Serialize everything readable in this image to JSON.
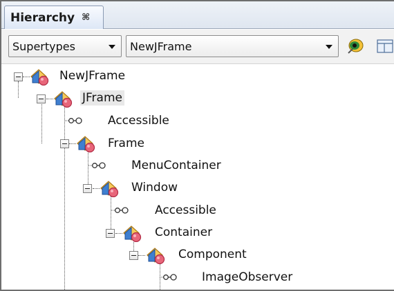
{
  "tab": {
    "title": "Hierarchy",
    "close_glyph": "⌘"
  },
  "toolbar": {
    "mode_select": {
      "value": "Supertypes"
    },
    "class_select": {
      "value": "NewJFrame"
    }
  },
  "icons": {
    "class": "class-icon",
    "interface": "interface-icon",
    "expanded": "collapse-toggle-icon",
    "eye": "eye-icon",
    "views": "view-layout-icon"
  },
  "tree": [
    {
      "label": "NewJFrame",
      "kind": "class",
      "depth": 0,
      "expanded": true
    },
    {
      "label": "JFrame",
      "kind": "class",
      "depth": 1,
      "expanded": true,
      "selected": true
    },
    {
      "label": "Accessible",
      "kind": "interface",
      "depth": 2
    },
    {
      "label": "Frame",
      "kind": "class",
      "depth": 2,
      "expanded": true
    },
    {
      "label": "MenuContainer",
      "kind": "interface",
      "depth": 3
    },
    {
      "label": "Window",
      "kind": "class",
      "depth": 3,
      "expanded": true
    },
    {
      "label": "Accessible",
      "kind": "interface",
      "depth": 4
    },
    {
      "label": "Container",
      "kind": "class",
      "depth": 4,
      "expanded": true
    },
    {
      "label": "Component",
      "kind": "class",
      "depth": 5,
      "expanded": true
    },
    {
      "label": "ImageObserver",
      "kind": "interface",
      "depth": 6
    }
  ]
}
